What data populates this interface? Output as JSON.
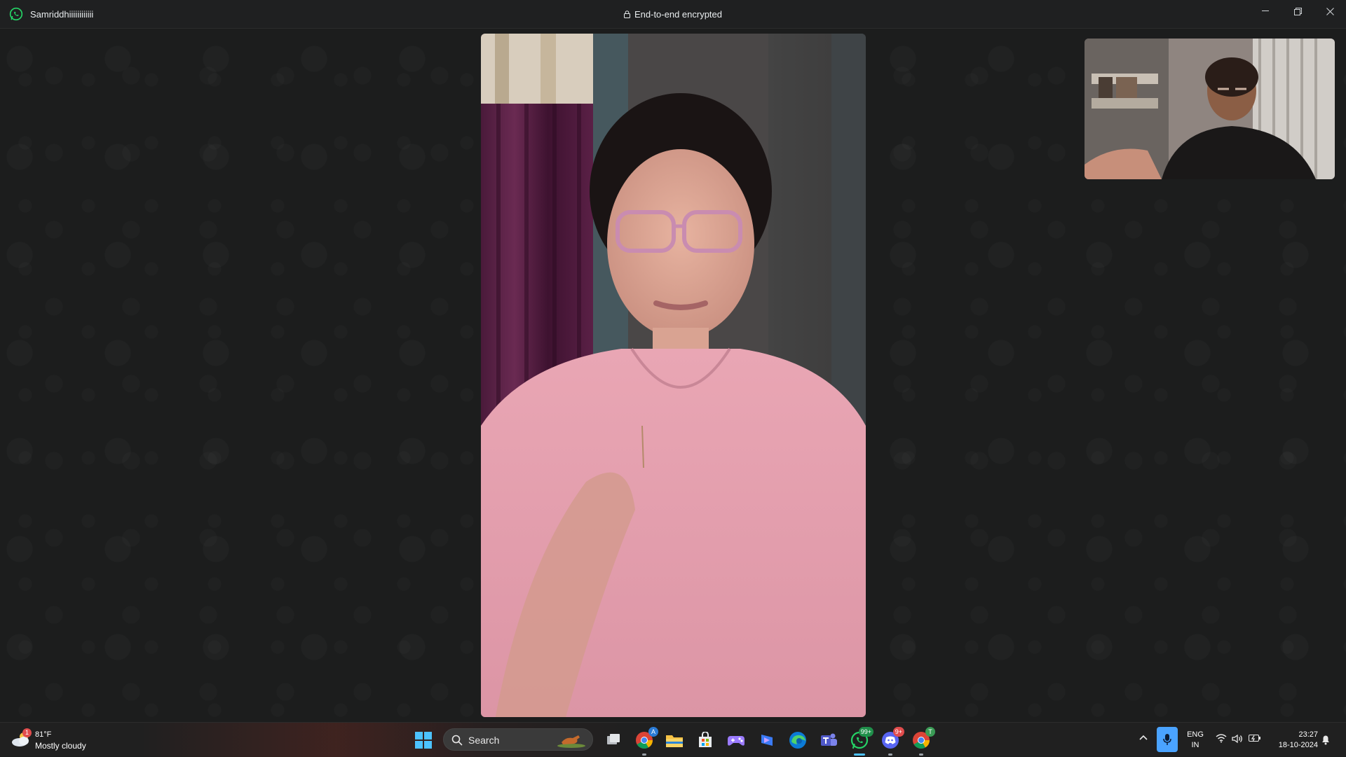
{
  "window": {
    "contact_name": "Samriddhiiiiiiiiiiii",
    "encryption_label": "End-to-end encrypted",
    "accent": "#25d366"
  },
  "call": {
    "main_video_label": "remote-participant-video",
    "self_view_label": "self-view-video"
  },
  "taskbar": {
    "weather": {
      "temp": "81°F",
      "condition": "Mostly cloudy",
      "badge": "1"
    },
    "search_label": "Search",
    "apps": [
      {
        "name": "task-view",
        "badge": ""
      },
      {
        "name": "chrome",
        "badge": "A"
      },
      {
        "name": "file-explorer",
        "badge": ""
      },
      {
        "name": "microsoft-store",
        "badge": ""
      },
      {
        "name": "game-controller",
        "badge": ""
      },
      {
        "name": "bing-copilot",
        "badge": ""
      },
      {
        "name": "edge",
        "badge": ""
      },
      {
        "name": "teams",
        "badge": ""
      },
      {
        "name": "whatsapp",
        "badge": "99+"
      },
      {
        "name": "discord",
        "badge": "9+"
      },
      {
        "name": "chrome-profile",
        "badge": "T"
      }
    ],
    "language": {
      "line1": "ENG",
      "line2": "IN"
    },
    "time": "23:27",
    "date": "18-10-2024"
  }
}
